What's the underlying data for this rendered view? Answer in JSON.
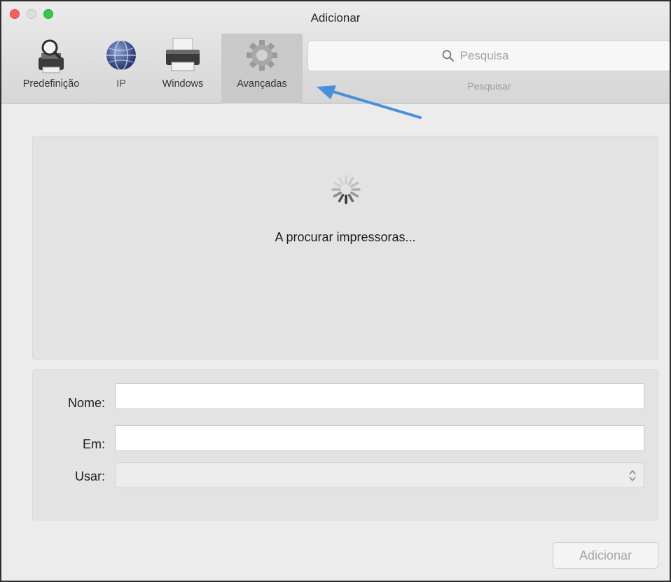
{
  "window": {
    "title": "Adicionar"
  },
  "toolbar": {
    "items": [
      {
        "label": "Predefinição",
        "icon": "default-printer-icon",
        "selected": false
      },
      {
        "label": "IP",
        "icon": "globe-icon",
        "selected": false
      },
      {
        "label": "Windows",
        "icon": "printer-icon",
        "selected": false
      },
      {
        "label": "Avançadas",
        "icon": "gear-icon",
        "selected": true
      }
    ],
    "search": {
      "placeholder": "Pesquisa",
      "caption": "Pesquisar"
    }
  },
  "browser": {
    "status_text": "A procurar impressoras..."
  },
  "form": {
    "name_label": "Nome:",
    "location_label": "Em:",
    "use_label": "Usar:",
    "name_value": "",
    "location_value": "",
    "use_value": ""
  },
  "actions": {
    "add_label": "Adicionar"
  },
  "colors": {
    "annotation_arrow": "#4a90d9",
    "close": "#fc605c",
    "maximize": "#34c84a"
  }
}
